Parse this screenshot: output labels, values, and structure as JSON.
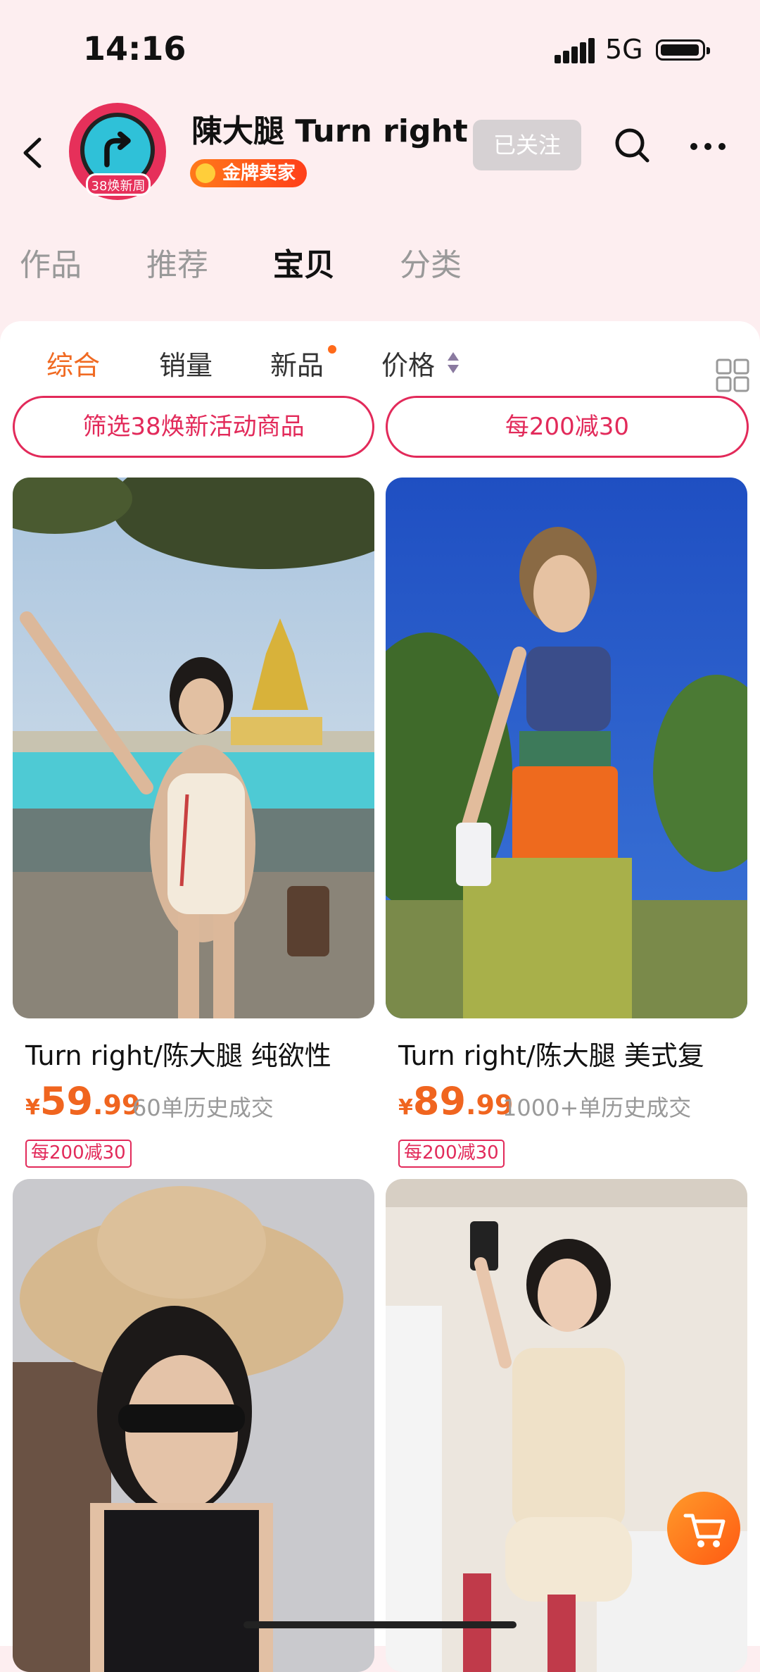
{
  "status_bar": {
    "time": "14:16",
    "network": "5G"
  },
  "header": {
    "shop_name": "陳大腿 Turn right",
    "logo_badge": "38焕新周",
    "seller_badge": "金牌卖家",
    "follow_label": "已关注"
  },
  "tabs": [
    {
      "label": "作品"
    },
    {
      "label": "推荐"
    },
    {
      "label": "宝贝",
      "active": true
    },
    {
      "label": "分类"
    }
  ],
  "filters": [
    {
      "label": "综合",
      "active": true
    },
    {
      "label": "销量"
    },
    {
      "label": "新品"
    },
    {
      "label": "价格"
    }
  ],
  "promos": [
    {
      "label": "筛选38焕新活动商品"
    },
    {
      "label": "每200减30"
    }
  ],
  "products": [
    {
      "title": "Turn right/陈大腿 纯欲性",
      "price_symbol": "¥",
      "price_int": "59",
      "price_dec": ".99",
      "sold": "60单历史成交",
      "tag": "每200减30"
    },
    {
      "title": "Turn right/陈大腿 美式复",
      "price_symbol": "¥",
      "price_int": "89",
      "price_dec": ".99",
      "sold": "1000+单历史成交",
      "tag": "每200减30"
    }
  ],
  "colors": {
    "accent": "#f06a22",
    "promo": "#e22a5a",
    "background": "#fdeef0"
  },
  "icons": [
    "back-icon",
    "search-icon",
    "more-icon",
    "grid-view-icon",
    "cart-icon"
  ]
}
